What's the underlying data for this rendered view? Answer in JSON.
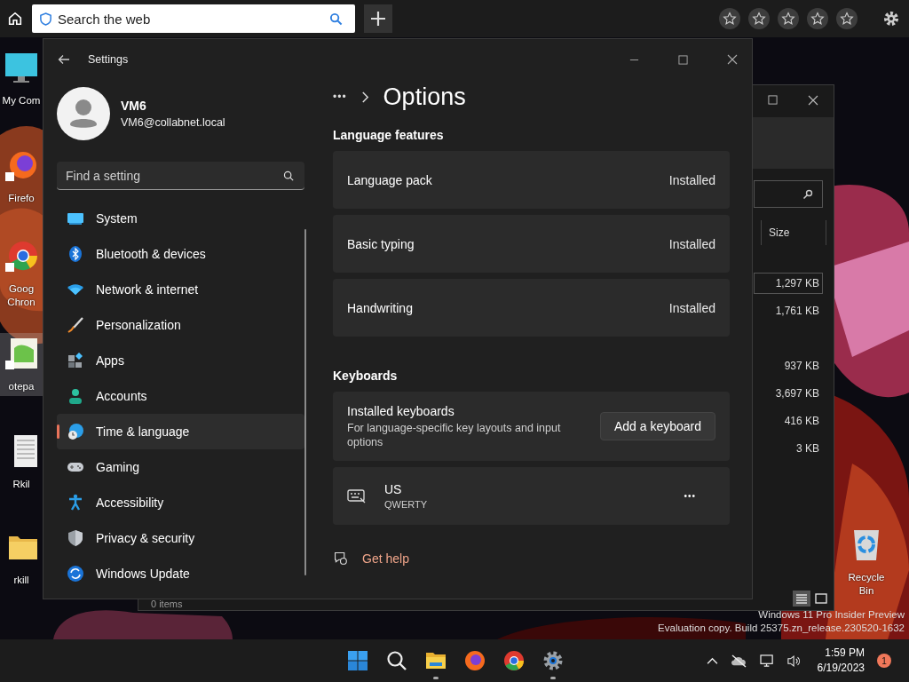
{
  "browser_bar": {
    "search": {
      "placeholder": "Search the web"
    },
    "favorites": [
      {
        "filled": false
      },
      {
        "filled": false
      },
      {
        "filled": false
      },
      {
        "filled": false
      },
      {
        "filled": false
      }
    ]
  },
  "desktop_icons": [
    {
      "kind": "monitor",
      "label": "My Com",
      "selected": false
    },
    {
      "kind": "firefox",
      "label": "Firefo",
      "selected": false
    },
    {
      "kind": "chrome",
      "label": "Goog Chron",
      "selected": false
    },
    {
      "kind": "notepad",
      "label": "otepa",
      "selected": true
    },
    {
      "kind": "document",
      "label": "Rkil",
      "selected": false
    },
    {
      "kind": "folder",
      "label": "rkill",
      "selected": false
    },
    {
      "kind": "recycle",
      "label": "Recycle Bin",
      "selected": false
    }
  ],
  "explorer": {
    "column": "Size",
    "rows": [
      {
        "kind": "file",
        "size": "1,297 KB",
        "selected": true
      },
      {
        "kind": "file",
        "size": "1,761 KB",
        "selected": false
      },
      {
        "kind": "folder",
        "selected": false
      },
      {
        "kind": "file",
        "size": "937 KB",
        "selected": false
      },
      {
        "kind": "file",
        "size": "3,697 KB",
        "selected": false
      },
      {
        "kind": "file",
        "size": "416 KB",
        "selected": false
      },
      {
        "kind": "file",
        "size": "3 KB",
        "selected": false
      }
    ],
    "status": "0 items",
    "view": [
      {
        "kind": "details",
        "selected": true
      },
      {
        "kind": "tiles",
        "selected": false
      }
    ]
  },
  "settings": {
    "title": "Settings",
    "user": {
      "name": "VM6",
      "email": "VM6@collabnet.local"
    },
    "search": {
      "placeholder": "Find a setting"
    },
    "nav": [
      {
        "kind": "system",
        "label": "System",
        "selected": false
      },
      {
        "kind": "bluetooth",
        "label": "Bluetooth & devices",
        "selected": false
      },
      {
        "kind": "network",
        "label": "Network & internet",
        "selected": false
      },
      {
        "kind": "brush",
        "label": "Personalization",
        "selected": false
      },
      {
        "kind": "apps",
        "label": "Apps",
        "selected": false
      },
      {
        "kind": "accounts",
        "label": "Accounts",
        "selected": false
      },
      {
        "kind": "time",
        "label": "Time & language",
        "selected": true
      },
      {
        "kind": "gaming",
        "label": "Gaming",
        "selected": false
      },
      {
        "kind": "accessibility",
        "label": "Accessibility",
        "selected": false
      },
      {
        "kind": "privacy",
        "label": "Privacy & security",
        "selected": false
      },
      {
        "kind": "update",
        "label": "Windows Update",
        "selected": false
      }
    ],
    "breadcrumb": {
      "more": "•••",
      "page": "Options"
    },
    "sections": [
      {
        "heading": "Language features",
        "rows": [
          {
            "kind": "status",
            "label": "Language pack",
            "status": "Installed"
          },
          {
            "kind": "status",
            "label": "Basic typing",
            "status": "Installed"
          },
          {
            "kind": "status",
            "label": "Handwriting",
            "status": "Installed"
          }
        ]
      },
      {
        "heading": "Keyboards",
        "rows": [
          {
            "kind": "action",
            "label": "Installed keyboards",
            "description": "For language-specific key layouts and input options",
            "button": "Add a keyboard"
          },
          {
            "kind": "keyboard",
            "label": "US",
            "description": "QWERTY",
            "more": "•••"
          }
        ]
      }
    ],
    "help_link": "Get help"
  },
  "os_watermark": [
    "Windows 11 Pro Insider Preview",
    "Evaluation copy. Build 25375.zn_release.230520-1632"
  ],
  "taskbar": {
    "apps": [
      {
        "kind": "start",
        "running": false
      },
      {
        "kind": "search",
        "running": false
      },
      {
        "kind": "files",
        "running": true
      },
      {
        "kind": "firefox",
        "running": false
      },
      {
        "kind": "chrome",
        "running": false
      },
      {
        "kind": "settings",
        "running": true
      }
    ],
    "time": "1:59 PM",
    "date": "6/19/2023",
    "notifications": "1"
  }
}
